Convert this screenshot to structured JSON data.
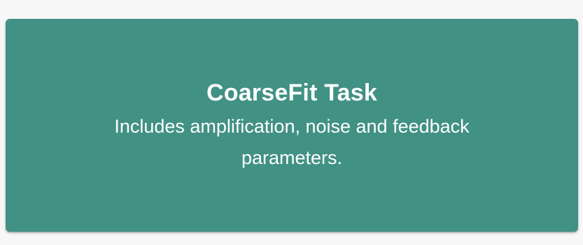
{
  "card": {
    "title": "CoarseFit Task",
    "description": "Includes amplification, noise and feedback parameters.",
    "background_color": "#419184",
    "text_color": "#ffffff"
  }
}
